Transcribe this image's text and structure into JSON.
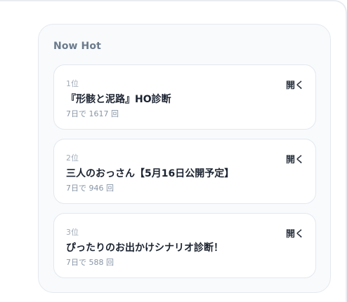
{
  "panel": {
    "title": "Now Hot",
    "items": [
      {
        "rank": "1位",
        "name": "『形骸と泥路』HO診断",
        "stat": "7日で 1617 回",
        "open_label": "開く"
      },
      {
        "rank": "2位",
        "name": "三人のおっさん【5月16日公開予定】",
        "stat": "7日で 946 回",
        "open_label": "開く"
      },
      {
        "rank": "3位",
        "name": "ぴったりのお出かけシナリオ診断！",
        "stat": "7日で 588 回",
        "open_label": "開く"
      }
    ]
  }
}
